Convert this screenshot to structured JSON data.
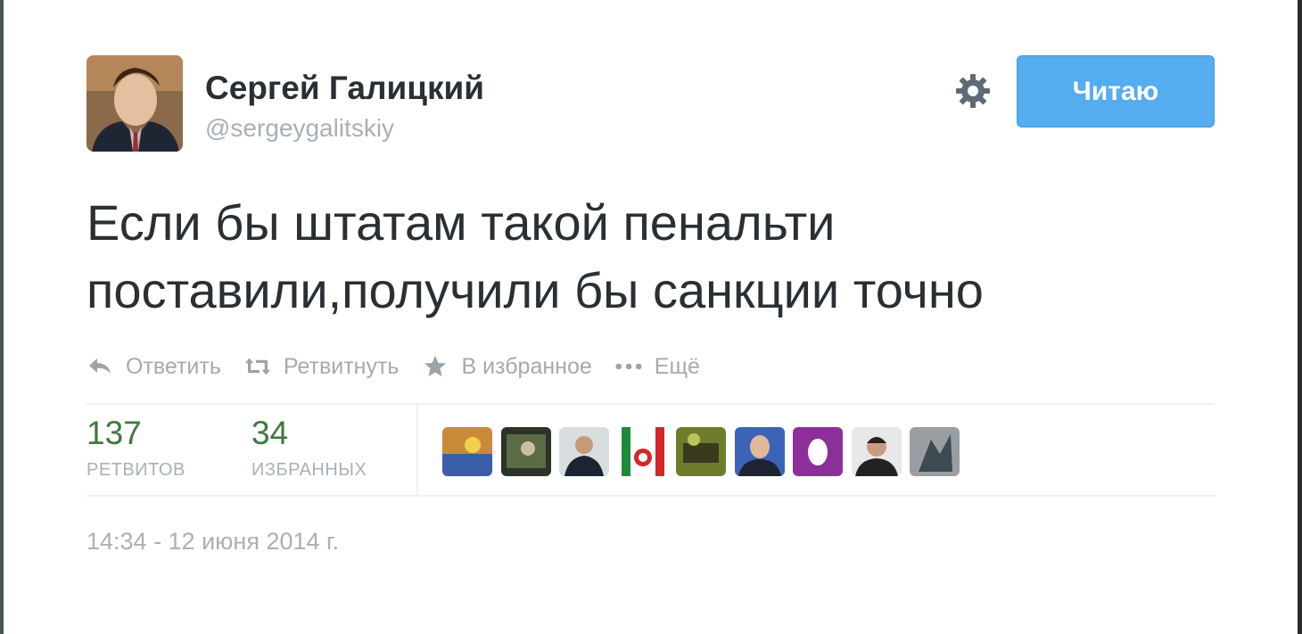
{
  "user": {
    "name": "Сергей Галицкий",
    "handle": "@sergeygalitskiy"
  },
  "follow_button": {
    "label": "Читаю",
    "color": "#55acee"
  },
  "tweet": {
    "line1": "Если бы штатам такой пенальти",
    "line2": "поставили,получили бы санкции точно"
  },
  "actions": [
    {
      "label": "Ответить",
      "icon": "reply-icon"
    },
    {
      "label": "Ретвитнуть",
      "icon": "retweet-icon"
    },
    {
      "label": "В избранное",
      "icon": "star-icon"
    },
    {
      "label": "Ещё",
      "icon": "more-icon"
    }
  ],
  "stats": {
    "retweets": {
      "count": "137",
      "caption": "РЕТВИТОВ"
    },
    "favorites": {
      "count": "34",
      "caption": "ИЗБРАННЫХ"
    }
  },
  "timestamp": "14:34 - 12 июня 2014 г.",
  "colors": {
    "accent": "#55acee",
    "stat_number": "#3c7a3c",
    "muted": "#a9b0b6"
  }
}
